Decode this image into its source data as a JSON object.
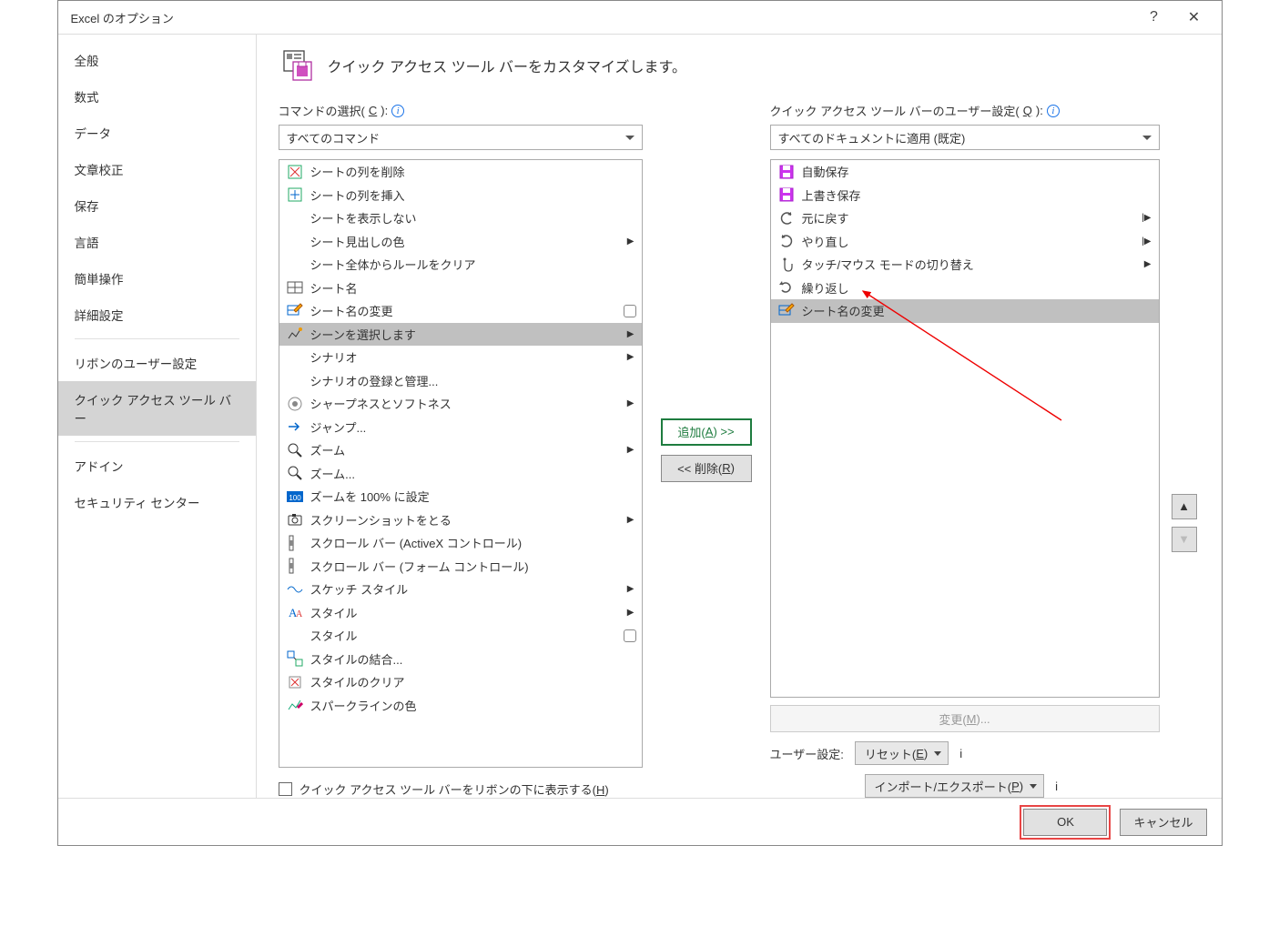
{
  "window": {
    "title": "Excel のオプション",
    "help": "?",
    "close": "✕"
  },
  "sidebar": {
    "items": [
      {
        "label": "全般"
      },
      {
        "label": "数式"
      },
      {
        "label": "データ"
      },
      {
        "label": "文章校正"
      },
      {
        "label": "保存"
      },
      {
        "label": "言語"
      },
      {
        "label": "簡単操作"
      },
      {
        "label": "詳細設定"
      },
      {
        "__div": true
      },
      {
        "label": "リボンのユーザー設定"
      },
      {
        "label": "クイック アクセス ツール バー",
        "selected": true
      },
      {
        "__div": true
      },
      {
        "label": "アドイン"
      },
      {
        "label": "セキュリティ センター"
      }
    ]
  },
  "heading": "クイック アクセス ツール バーをカスタマイズします。",
  "left": {
    "label": "コマンドの選択(",
    "label_u": "C",
    "label_end": "):",
    "dropdown": "すべてのコマンド",
    "check_label": "クイック アクセス ツール バーをリボンの下に表示する(",
    "check_u": "H",
    "check_end": ")"
  },
  "left_items": [
    {
      "icon": "del-col",
      "label": "シートの列を削除"
    },
    {
      "icon": "ins-col",
      "label": "シートの列を挿入"
    },
    {
      "icon": "",
      "label": "シートを表示しない"
    },
    {
      "icon": "",
      "label": "シート見出しの色",
      "sub": true
    },
    {
      "icon": "",
      "label": "シート全体からルールをクリア"
    },
    {
      "icon": "grid",
      "label": "シート名"
    },
    {
      "icon": "grid-edit",
      "label": "シート名の変更",
      "seg": true
    },
    {
      "icon": "spark",
      "label": "シーンを選択します",
      "sub": true,
      "selected": true
    },
    {
      "icon": "",
      "label": "シナリオ",
      "sub": true
    },
    {
      "icon": "",
      "label": "シナリオの登録と管理..."
    },
    {
      "icon": "sharp",
      "label": "シャープネスとソフトネス",
      "sub": true
    },
    {
      "icon": "jump",
      "label": "ジャンプ..."
    },
    {
      "icon": "zoom",
      "label": "ズーム",
      "sub": true
    },
    {
      "icon": "zoom",
      "label": "ズーム..."
    },
    {
      "icon": "100",
      "label": "ズームを 100% に設定"
    },
    {
      "icon": "cam",
      "label": "スクリーンショットをとる",
      "sub": true
    },
    {
      "icon": "scroll",
      "label": "スクロール バー (ActiveX コントロール)"
    },
    {
      "icon": "scroll",
      "label": "スクロール バー (フォーム コントロール)"
    },
    {
      "icon": "wave",
      "label": "スケッチ スタイル",
      "sub": true
    },
    {
      "icon": "Aa",
      "label": "スタイル",
      "sub": true
    },
    {
      "icon": "",
      "label": "スタイル",
      "seg": true
    },
    {
      "icon": "merge",
      "label": "スタイルの結合..."
    },
    {
      "icon": "clear",
      "label": "スタイルのクリア"
    },
    {
      "icon": "sparkc",
      "label": "スパークラインの色"
    }
  ],
  "mid": {
    "add_pre": "追加(",
    "add_u": "A",
    "add_post": ") >>",
    "rem_pre": "<< 削除(",
    "rem_u": "R",
    "rem_post": ")"
  },
  "right": {
    "label": "クイック アクセス ツール バーのユーザー設定(",
    "label_u": "Q",
    "label_end": "):",
    "dropdown": "すべてのドキュメントに適用 (既定)",
    "modify_pre": "変更(",
    "modify_u": "M",
    "modify_post": ")...",
    "user_label": "ユーザー設定:",
    "reset_pre": "リセット(",
    "reset_u": "E",
    "reset_post": ")",
    "import_pre": "インポート/エクスポート(",
    "import_u": "P",
    "import_post": ")"
  },
  "right_items": [
    {
      "icon": "save-p",
      "label": "自動保存"
    },
    {
      "icon": "save-p",
      "label": "上書き保存"
    },
    {
      "icon": "undo",
      "label": "元に戻す",
      "split": true
    },
    {
      "icon": "redo",
      "label": "やり直し",
      "split": true
    },
    {
      "icon": "touch",
      "label": "タッチ/マウス モードの切り替え",
      "sub": true
    },
    {
      "icon": "repeat",
      "label": "繰り返し"
    },
    {
      "icon": "grid-edit",
      "label": "シート名の変更",
      "selected": true
    }
  ],
  "footer": {
    "ok": "OK",
    "cancel": "キャンセル"
  }
}
